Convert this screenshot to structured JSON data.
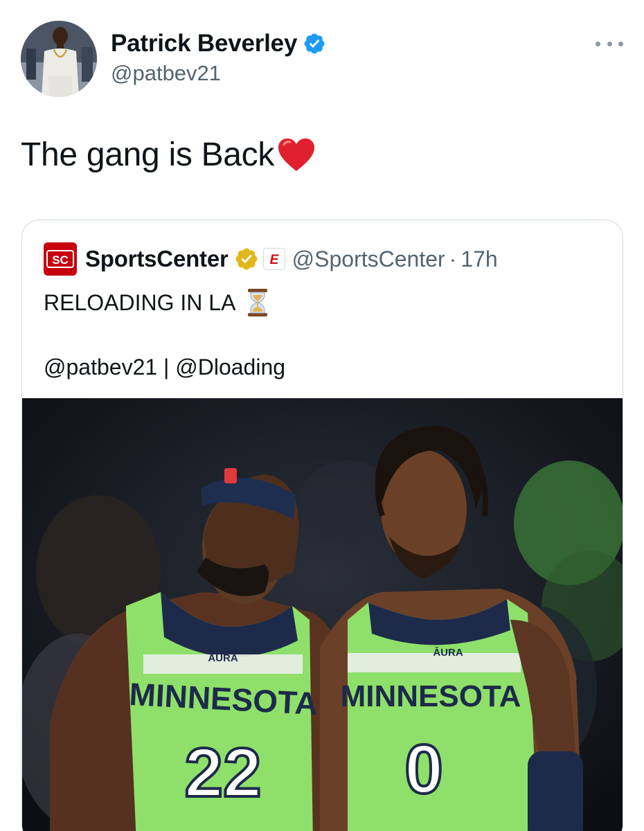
{
  "author": {
    "name": "Patrick Beverley",
    "handle": "@patbev21"
  },
  "tweet": {
    "text": "The gang is Back"
  },
  "quoted_tweet": {
    "name": "SportsCenter",
    "logo_text": "SC",
    "handle": "@SportsCenter",
    "separator": "·",
    "time": "17h",
    "line1": "RELOADING IN LA",
    "line2": "@patbev21 | @Dloading",
    "espn_mark": "E"
  },
  "media": {
    "left_jersey": {
      "team": "MINNESOTA",
      "number": "22",
      "sponsor": "ĀURA"
    },
    "right_jersey": {
      "team": "MINNESOTA",
      "number": "0",
      "sponsor": "ĀURA"
    }
  },
  "colors": {
    "verified_blue": "#1d9bf0",
    "gold_check": "#e2b719",
    "sc_red": "#c6000e",
    "jersey_green": "#8fe06a",
    "jersey_navy": "#1d2a4a"
  },
  "icons": {
    "verified": "verified-badge-icon",
    "gold": "gold-check-icon",
    "more": "more-dots-icon",
    "heart": "red-heart-icon",
    "hourglass": "hourglass-icon"
  }
}
